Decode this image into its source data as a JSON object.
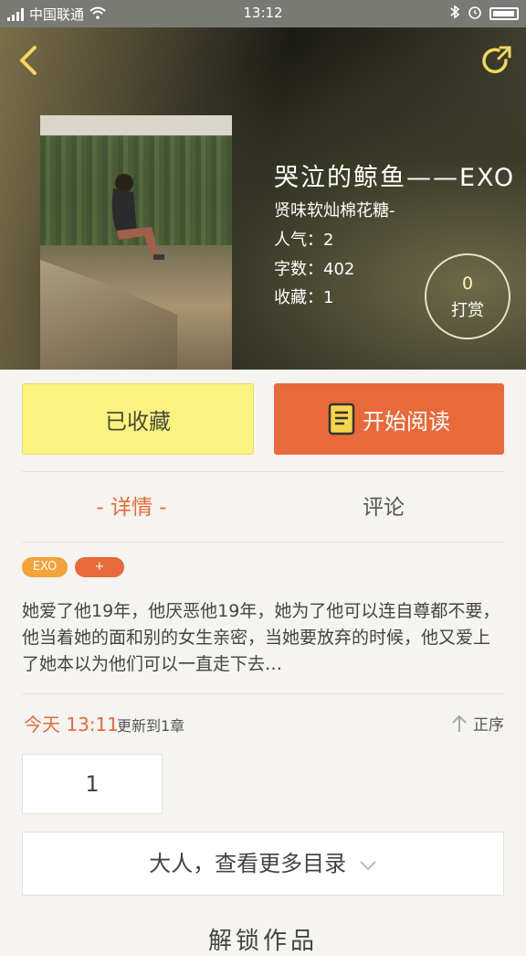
{
  "status_bar": {
    "carrier": "中国联通",
    "time": "13:12"
  },
  "book": {
    "title": "哭泣的鲸鱼——EXO",
    "author": "贤味软灿棉花糖-",
    "popularity_label": "人气：",
    "popularity": "2",
    "words_label": "字数：",
    "words": "402",
    "favorites_label": "收藏：",
    "favorites": "1"
  },
  "tip": {
    "count": "0",
    "label": "打赏"
  },
  "actions": {
    "favorited_label": "已收藏",
    "read_label": "开始阅读"
  },
  "tabs": {
    "detail": "- 详情 -",
    "comment": "评论"
  },
  "tags": [
    {
      "label": "EXO",
      "color": "#f2a33a"
    },
    {
      "label": "+",
      "color": "#e8693a"
    }
  ],
  "description": "她爱了他19年，他厌恶他19年，她为了他可以连自尊都不要，他当着她的面和别的女生亲密，当她要放弃的时候，他又爱上了她本以为他们可以一直走下去…",
  "update": {
    "today": "今天 13:11",
    "text": "更新到1章",
    "sort_label": "正序"
  },
  "chapters": [
    "1"
  ],
  "more_label": "大人，查看更多目录",
  "cut_heading": "解锁作品",
  "colors": {
    "accent": "#e8693a",
    "favorite_bg": "#fbf37f"
  }
}
